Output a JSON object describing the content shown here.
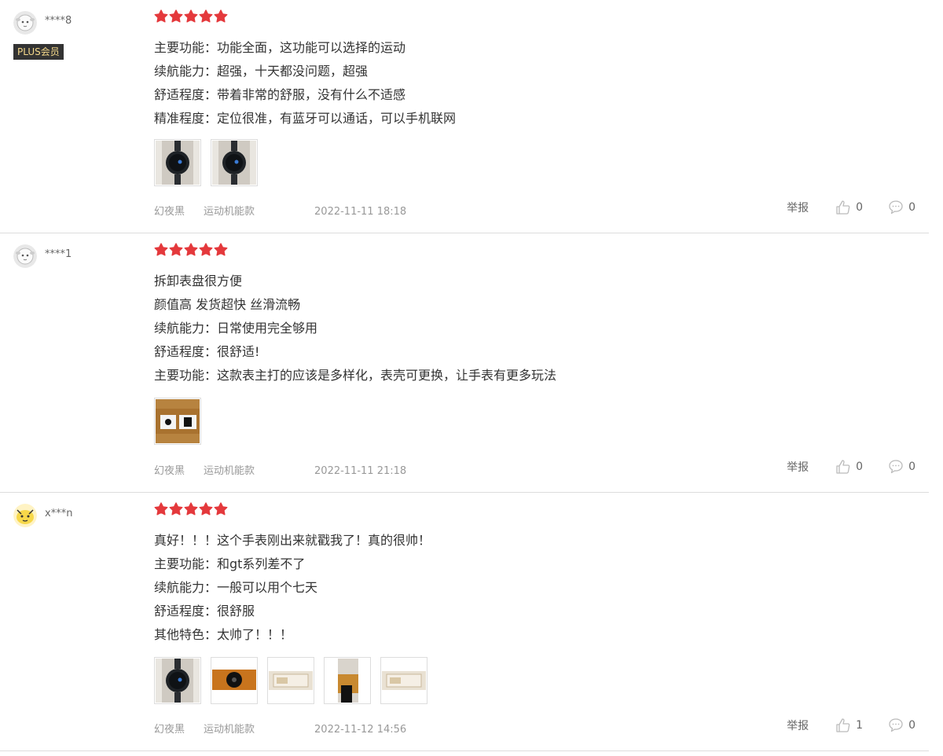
{
  "colors": {
    "star": "#e4393c",
    "plus_bg": "#333333",
    "plus_text": "#f5d98b",
    "meta": "#999999"
  },
  "reviews": [
    {
      "user": "****8",
      "badge": "PLUS会员",
      "avatar_icon": "sheep-avatar-icon",
      "rating": 5,
      "lines": [
        "主要功能：功能全面，这功能可以选择的运动",
        "续航能力：超强，十天都没问题，超强",
        "舒适程度：带着非常的舒服，没有什么不适感",
        "精准程度：定位很准，有蓝牙可以通话，可以手机联网"
      ],
      "images": [
        "watch-photo",
        "watch-photo"
      ],
      "color": "幻夜黑",
      "model": "运动机能款",
      "time": "2022-11-11 18:18",
      "report": "举报",
      "likes": "0",
      "replies": "0"
    },
    {
      "user": "****1",
      "badge": "",
      "avatar_icon": "sheep-avatar-icon",
      "rating": 5,
      "lines": [
        "拆卸表盘很方便",
        "颜值高 发货超快 丝滑流畅",
        "续航能力：日常使用完全够用",
        "舒适程度：很舒适!",
        "主要功能：这款表主打的应该是多样化，表壳可更换，让手表有更多玩法"
      ],
      "images": [
        "watch-box-photo"
      ],
      "color": "幻夜黑",
      "model": "运动机能款",
      "time": "2022-11-11 21:18",
      "report": "举报",
      "likes": "0",
      "replies": "0"
    },
    {
      "user": "x***n",
      "badge": "",
      "avatar_icon": "cartoon-avatar-icon",
      "rating": 5,
      "lines": [
        "真好！！！这个手表刚出来就戳我了！真的很帅！",
        "主要功能：和gt系列差不了",
        "续航能力：一般可以用个七天",
        "舒适程度：很舒服",
        "其他特色：太帅了！！！"
      ],
      "images": [
        "watch-photo",
        "watch-dark-photo",
        "box-photo",
        "wrist-photo",
        "box-photo"
      ],
      "color": "幻夜黑",
      "model": "运动机能款",
      "time": "2022-11-12 14:56",
      "report": "举报",
      "likes": "1",
      "replies": "0"
    }
  ]
}
